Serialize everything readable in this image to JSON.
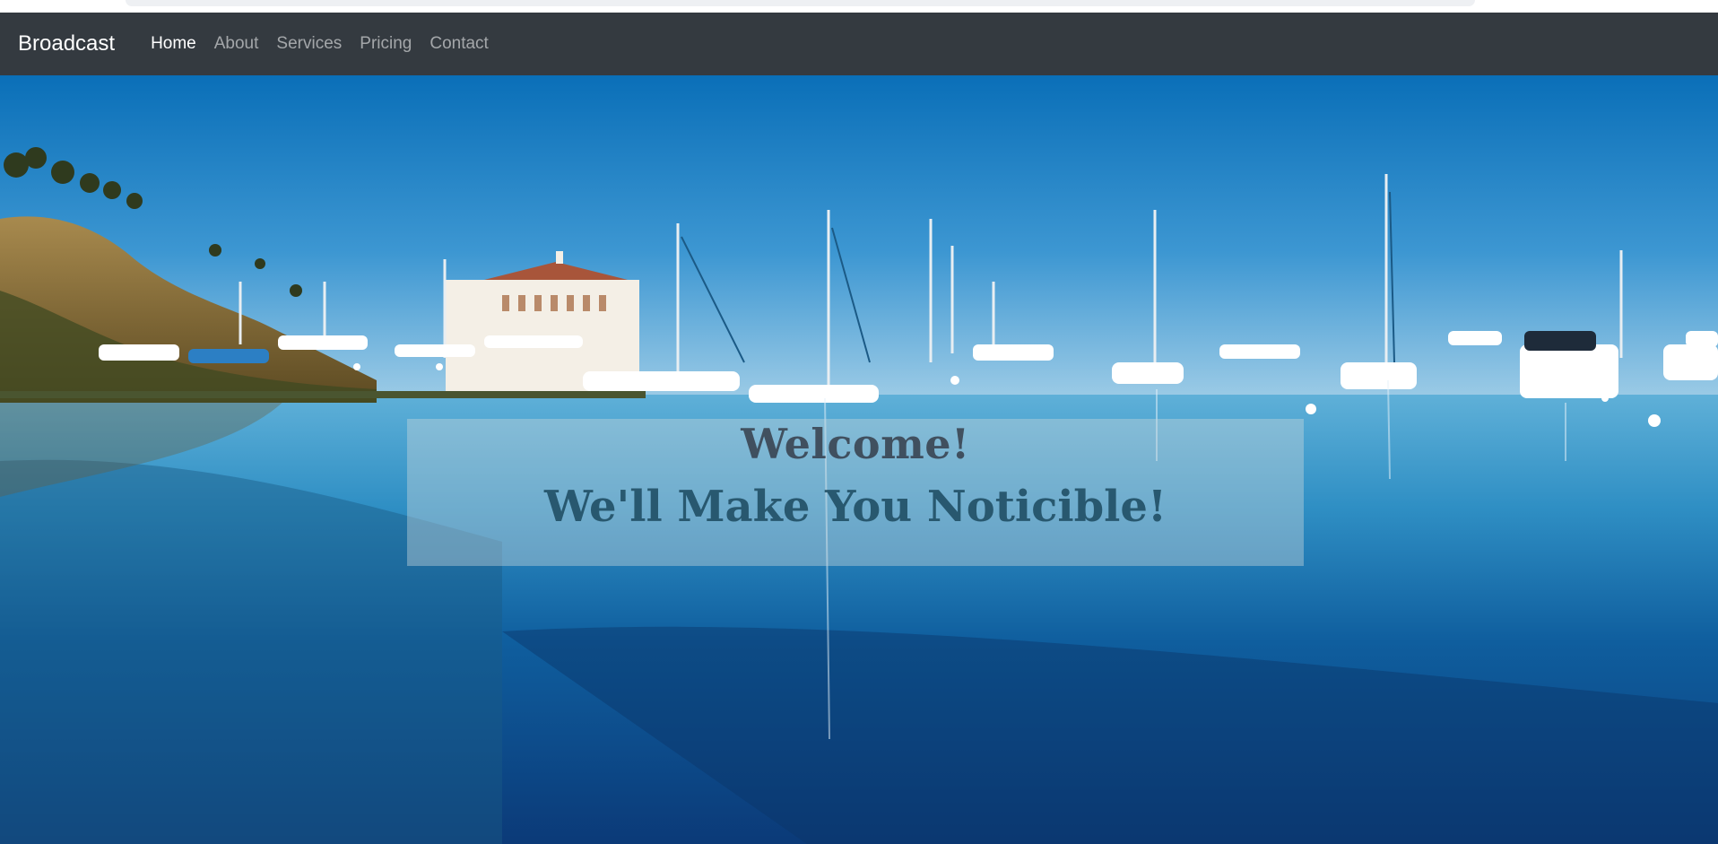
{
  "navbar": {
    "brand": "Broadcast",
    "links": [
      {
        "label": "Home",
        "active": true
      },
      {
        "label": "About",
        "active": false
      },
      {
        "label": "Services",
        "active": false
      },
      {
        "label": "Pricing",
        "active": false
      },
      {
        "label": "Contact",
        "active": false
      }
    ]
  },
  "hero": {
    "title": "Welcome!",
    "subtitle": "We'll Make You Noticible!"
  },
  "colors": {
    "navbar_bg": "#343a40",
    "sky_top": "#0a6fb8",
    "sky_horizon": "#8ec6e6",
    "water_light": "#3fa3d3",
    "water_deep": "#0b3a78"
  }
}
